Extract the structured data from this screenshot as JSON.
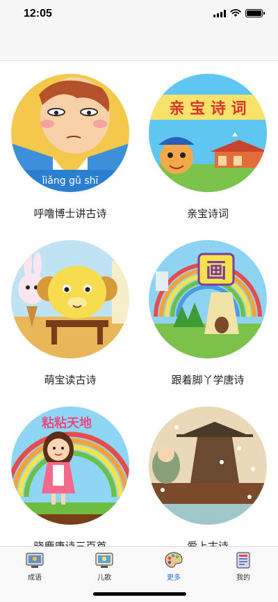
{
  "status_bar": {
    "time": "12:05"
  },
  "items": [
    {
      "label": "呼噜博士讲古诗",
      "thumb_text": "ǐiǎng gǔ  shī"
    },
    {
      "label": "亲宝诗词",
      "thumb_text": "亲 宝 诗 词"
    },
    {
      "label": "萌宝读古诗"
    },
    {
      "label": "跟着脚丫学唐诗",
      "thumb_text": "画"
    },
    {
      "label": "晓鹿唐诗三百首",
      "thumb_text": "粘粘天地"
    },
    {
      "label": "爱上古诗"
    }
  ],
  "tabs": [
    {
      "label": "成语",
      "icon": "idiom-icon"
    },
    {
      "label": "儿歌",
      "icon": "nursery-rhyme-icon"
    },
    {
      "label": "更多",
      "icon": "palette-icon",
      "active": true
    },
    {
      "label": "我的",
      "icon": "profile-icon"
    }
  ],
  "colors": {
    "active_tab": "#2a6fd6",
    "label_text": "#222222"
  }
}
